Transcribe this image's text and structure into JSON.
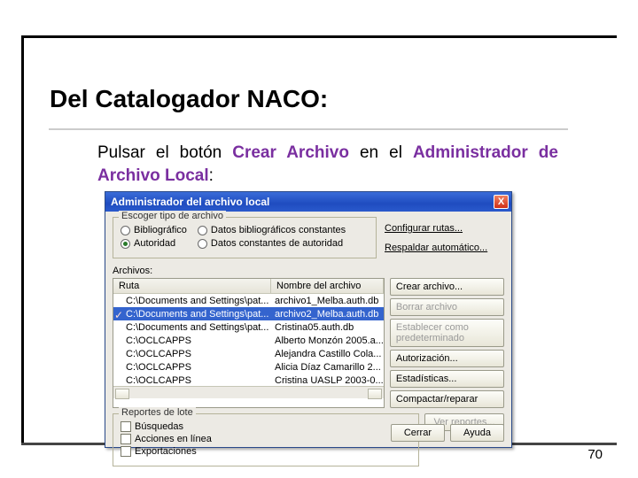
{
  "slide": {
    "title": "Del Catalogador NACO:",
    "text_pre": "Pulsar el botón ",
    "text_hl1": "Crear Archivo",
    "text_mid": " en el ",
    "text_hl2": "Administrador de Archivo Local",
    "text_post": ":",
    "page_number": "70"
  },
  "dialog": {
    "title": "Administrador del archivo local",
    "close": "X",
    "filetype": {
      "legend": "Escoger tipo de archivo",
      "opts": {
        "bibliografico": "Bibliográfico",
        "autoridad": "Autoridad",
        "datos_bib_const": "Datos bibliográficos constantes",
        "datos_const_aut": "Datos constantes de autoridad"
      },
      "selected": "autoridad"
    },
    "configure_paths": "Configurar rutas...",
    "backup_auto": "Respaldar automático...",
    "files_label": "Archivos:",
    "columns": {
      "path": "Ruta",
      "name": "Nombre del archivo"
    },
    "rows": [
      {
        "path": "C:\\Documents and Settings\\pat...",
        "name": "archivo1_Melba.auth.db",
        "checked": false,
        "selected": false
      },
      {
        "path": "C:\\Documents and Settings\\pat...",
        "name": "archivo2_Melba.auth.db",
        "checked": true,
        "selected": true
      },
      {
        "path": "C:\\Documents and Settings\\pat...",
        "name": "Cristina05.auth.db",
        "checked": false,
        "selected": false
      },
      {
        "path": "C:\\OCLCAPPS",
        "name": "Alberto Monzón 2005.a...",
        "checked": false,
        "selected": false
      },
      {
        "path": "C:\\OCLCAPPS",
        "name": "Alejandra Castillo Cola...",
        "checked": false,
        "selected": false
      },
      {
        "path": "C:\\OCLCAPPS",
        "name": "Alicia Díaz Camarillo 2...",
        "checked": false,
        "selected": false
      },
      {
        "path": "C:\\OCLCAPPS",
        "name": "Cristina UASLP 2003-0...",
        "checked": false,
        "selected": false
      }
    ],
    "side_buttons": {
      "create": "Crear archivo...",
      "delete": "Borrar archivo",
      "set_default": "Establecer como predeterminado",
      "authorization": "Autorización...",
      "statistics": "Estadísticas...",
      "compact": "Compactar/reparar"
    },
    "lot_reports": {
      "legend": "Reportes de lote",
      "searches": "Búsquedas",
      "online_actions": "Acciones en línea",
      "exports": "Exportaciones",
      "view_reports": "Ver reportes..."
    },
    "bottom": {
      "close": "Cerrar",
      "help": "Ayuda"
    }
  }
}
